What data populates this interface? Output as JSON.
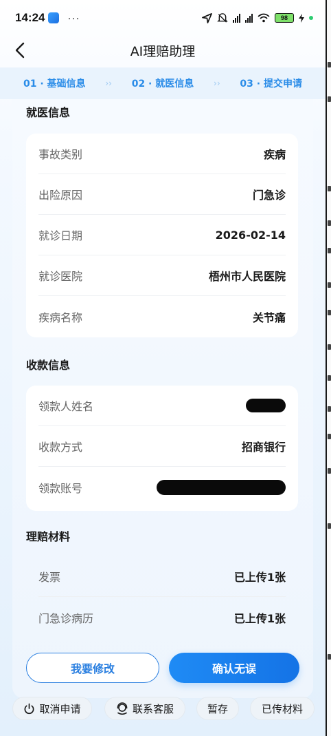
{
  "status_bar": {
    "time": "14:24",
    "more": "···",
    "battery": "98"
  },
  "nav": {
    "title": "AI理赔助理"
  },
  "steps": [
    {
      "label": "01 · 基础信息"
    },
    {
      "label": "02 · 就医信息"
    },
    {
      "label": "03 · 提交申请"
    }
  ],
  "medical": {
    "title": "就医信息",
    "rows": [
      {
        "label": "事故类别",
        "value": "疾病"
      },
      {
        "label": "出险原因",
        "value": "门急诊"
      },
      {
        "label": "就诊日期",
        "value": "2026-02-14"
      },
      {
        "label": "就诊医院",
        "value": "梧州市人民医院"
      },
      {
        "label": "疾病名称",
        "value": "关节痛"
      }
    ]
  },
  "payment": {
    "title": "收款信息",
    "rows": [
      {
        "label": "领款人姓名",
        "value": ""
      },
      {
        "label": "收款方式",
        "value": "招商银行"
      },
      {
        "label": "领款账号",
        "value": ""
      }
    ]
  },
  "materials": {
    "title": "理赔材料",
    "rows": [
      {
        "label": "发票",
        "value": "已上传1张"
      },
      {
        "label": "门急诊病历",
        "value": "已上传1张"
      }
    ]
  },
  "actions": {
    "modify": "我要修改",
    "confirm": "确认无误"
  },
  "bottom_bar": {
    "cancel": "取消申请",
    "service": "联系客服",
    "save": "暂存",
    "uploaded": "已传材料"
  },
  "colors": {
    "accent": "#2a7fe0",
    "step_text": "#2a8ce8",
    "step_bg": "#e9f3fd"
  }
}
